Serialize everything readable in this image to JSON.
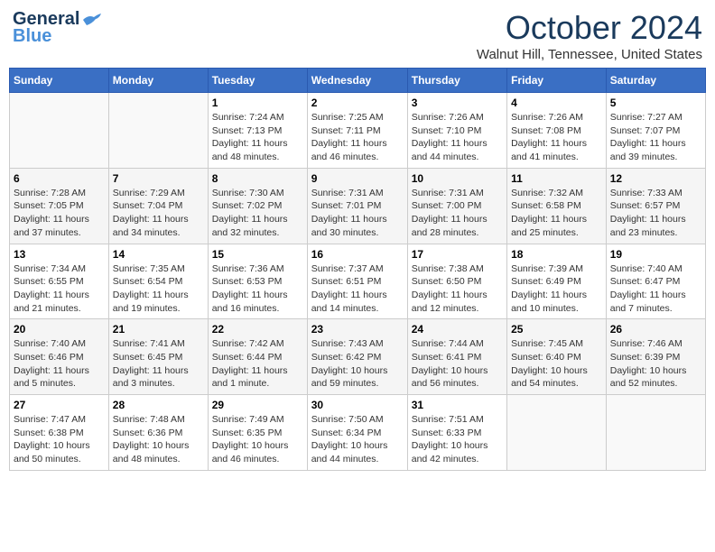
{
  "header": {
    "logo": {
      "line1": "General",
      "line2": "Blue"
    },
    "title": "October 2024",
    "location": "Walnut Hill, Tennessee, United States"
  },
  "calendar": {
    "days_of_week": [
      "Sunday",
      "Monday",
      "Tuesday",
      "Wednesday",
      "Thursday",
      "Friday",
      "Saturday"
    ],
    "weeks": [
      [
        {
          "day": "",
          "info": ""
        },
        {
          "day": "",
          "info": ""
        },
        {
          "day": "1",
          "info": "Sunrise: 7:24 AM\nSunset: 7:13 PM\nDaylight: 11 hours and 48 minutes."
        },
        {
          "day": "2",
          "info": "Sunrise: 7:25 AM\nSunset: 7:11 PM\nDaylight: 11 hours and 46 minutes."
        },
        {
          "day": "3",
          "info": "Sunrise: 7:26 AM\nSunset: 7:10 PM\nDaylight: 11 hours and 44 minutes."
        },
        {
          "day": "4",
          "info": "Sunrise: 7:26 AM\nSunset: 7:08 PM\nDaylight: 11 hours and 41 minutes."
        },
        {
          "day": "5",
          "info": "Sunrise: 7:27 AM\nSunset: 7:07 PM\nDaylight: 11 hours and 39 minutes."
        }
      ],
      [
        {
          "day": "6",
          "info": "Sunrise: 7:28 AM\nSunset: 7:05 PM\nDaylight: 11 hours and 37 minutes."
        },
        {
          "day": "7",
          "info": "Sunrise: 7:29 AM\nSunset: 7:04 PM\nDaylight: 11 hours and 34 minutes."
        },
        {
          "day": "8",
          "info": "Sunrise: 7:30 AM\nSunset: 7:02 PM\nDaylight: 11 hours and 32 minutes."
        },
        {
          "day": "9",
          "info": "Sunrise: 7:31 AM\nSunset: 7:01 PM\nDaylight: 11 hours and 30 minutes."
        },
        {
          "day": "10",
          "info": "Sunrise: 7:31 AM\nSunset: 7:00 PM\nDaylight: 11 hours and 28 minutes."
        },
        {
          "day": "11",
          "info": "Sunrise: 7:32 AM\nSunset: 6:58 PM\nDaylight: 11 hours and 25 minutes."
        },
        {
          "day": "12",
          "info": "Sunrise: 7:33 AM\nSunset: 6:57 PM\nDaylight: 11 hours and 23 minutes."
        }
      ],
      [
        {
          "day": "13",
          "info": "Sunrise: 7:34 AM\nSunset: 6:55 PM\nDaylight: 11 hours and 21 minutes."
        },
        {
          "day": "14",
          "info": "Sunrise: 7:35 AM\nSunset: 6:54 PM\nDaylight: 11 hours and 19 minutes."
        },
        {
          "day": "15",
          "info": "Sunrise: 7:36 AM\nSunset: 6:53 PM\nDaylight: 11 hours and 16 minutes."
        },
        {
          "day": "16",
          "info": "Sunrise: 7:37 AM\nSunset: 6:51 PM\nDaylight: 11 hours and 14 minutes."
        },
        {
          "day": "17",
          "info": "Sunrise: 7:38 AM\nSunset: 6:50 PM\nDaylight: 11 hours and 12 minutes."
        },
        {
          "day": "18",
          "info": "Sunrise: 7:39 AM\nSunset: 6:49 PM\nDaylight: 11 hours and 10 minutes."
        },
        {
          "day": "19",
          "info": "Sunrise: 7:40 AM\nSunset: 6:47 PM\nDaylight: 11 hours and 7 minutes."
        }
      ],
      [
        {
          "day": "20",
          "info": "Sunrise: 7:40 AM\nSunset: 6:46 PM\nDaylight: 11 hours and 5 minutes."
        },
        {
          "day": "21",
          "info": "Sunrise: 7:41 AM\nSunset: 6:45 PM\nDaylight: 11 hours and 3 minutes."
        },
        {
          "day": "22",
          "info": "Sunrise: 7:42 AM\nSunset: 6:44 PM\nDaylight: 11 hours and 1 minute."
        },
        {
          "day": "23",
          "info": "Sunrise: 7:43 AM\nSunset: 6:42 PM\nDaylight: 10 hours and 59 minutes."
        },
        {
          "day": "24",
          "info": "Sunrise: 7:44 AM\nSunset: 6:41 PM\nDaylight: 10 hours and 56 minutes."
        },
        {
          "day": "25",
          "info": "Sunrise: 7:45 AM\nSunset: 6:40 PM\nDaylight: 10 hours and 54 minutes."
        },
        {
          "day": "26",
          "info": "Sunrise: 7:46 AM\nSunset: 6:39 PM\nDaylight: 10 hours and 52 minutes."
        }
      ],
      [
        {
          "day": "27",
          "info": "Sunrise: 7:47 AM\nSunset: 6:38 PM\nDaylight: 10 hours and 50 minutes."
        },
        {
          "day": "28",
          "info": "Sunrise: 7:48 AM\nSunset: 6:36 PM\nDaylight: 10 hours and 48 minutes."
        },
        {
          "day": "29",
          "info": "Sunrise: 7:49 AM\nSunset: 6:35 PM\nDaylight: 10 hours and 46 minutes."
        },
        {
          "day": "30",
          "info": "Sunrise: 7:50 AM\nSunset: 6:34 PM\nDaylight: 10 hours and 44 minutes."
        },
        {
          "day": "31",
          "info": "Sunrise: 7:51 AM\nSunset: 6:33 PM\nDaylight: 10 hours and 42 minutes."
        },
        {
          "day": "",
          "info": ""
        },
        {
          "day": "",
          "info": ""
        }
      ]
    ]
  }
}
